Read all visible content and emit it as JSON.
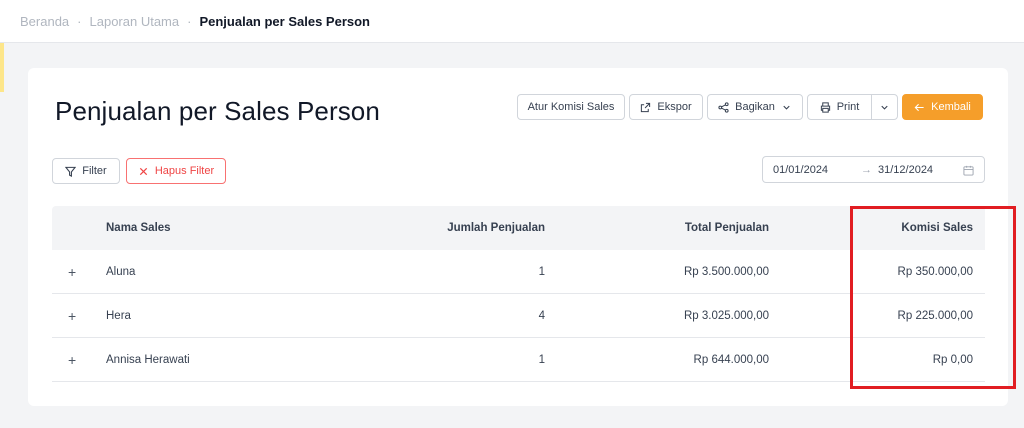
{
  "breadcrumb": {
    "items": [
      "Beranda",
      "Laporan Utama"
    ],
    "separator": "·",
    "current": "Penjualan per Sales Person"
  },
  "page": {
    "title": "Penjualan per Sales Person"
  },
  "toolbar": {
    "atur_komisi": "Atur Komisi Sales",
    "ekspor": "Ekspor",
    "bagikan": "Bagikan",
    "print": "Print",
    "kembali": "Kembali"
  },
  "filters": {
    "filter": "Filter",
    "hapus_filter": "Hapus Filter"
  },
  "date_range": {
    "start": "01/01/2024",
    "arrow": "→",
    "end": "31/12/2024"
  },
  "table": {
    "columns": [
      "Nama Sales",
      "Jumlah Penjualan",
      "Total Penjualan",
      "Komisi Sales"
    ],
    "rows": [
      {
        "expand": "+",
        "name": "Aluna",
        "qty": "1",
        "total": "Rp 3.500.000,00",
        "komisi": "Rp 350.000,00"
      },
      {
        "expand": "+",
        "name": "Hera",
        "qty": "4",
        "total": "Rp 3.025.000,00",
        "komisi": "Rp 225.000,00"
      },
      {
        "expand": "+",
        "name": "Annisa Herawati",
        "qty": "1",
        "total": "Rp 644.000,00",
        "komisi": "Rp 0,00"
      }
    ]
  },
  "colors": {
    "accent": "#f59e2a",
    "danger": "#ef4444",
    "highlight": "#e11d22"
  }
}
